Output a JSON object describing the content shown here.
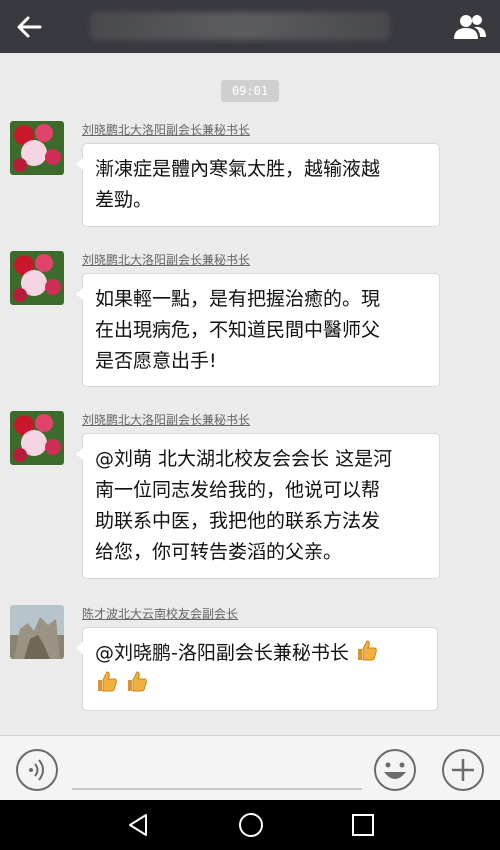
{
  "header": {
    "back_icon": "arrow-left-icon",
    "contacts_icon": "group-people-icon",
    "bg_color": "#393a3f"
  },
  "chat": {
    "timestamp": "09:01",
    "messages": [
      {
        "sender": "刘晓鹏北大洛阳副会长兼秘书长",
        "lines": [
          "漸凍症是體內寒氣太胜，越输液越",
          "差勁。"
        ]
      },
      {
        "sender": "刘晓鹏北大洛阳副会长兼秘书长",
        "lines": [
          "如果輕一點，是有把握治癒的。現",
          "在出現病危，不知道民間中醫师父",
          "是否愿意出手!"
        ]
      },
      {
        "sender": "刘晓鹏北大洛阳副会长兼秘书长",
        "lines": [
          "@刘萌 北大湖北校友会会长 这是河",
          "南一位同志发给我的，他说可以帮",
          "助联系中医，我把他的联系方法发",
          "给您，你可转告娄滔的父亲。"
        ]
      },
      {
        "sender": "陈才波北大云南校友会副会长",
        "lines": [
          "@刘晓鹏-洛阳副会长兼秘书长"
        ],
        "emoji": "thumbs-up-icon"
      }
    ]
  },
  "input_bar": {
    "voice_icon": "voice-icon",
    "emoji_icon": "smiley-icon",
    "more_icon": "plus-icon"
  },
  "system_nav": {
    "back_icon": "triangle-back-icon",
    "home_icon": "circle-home-icon",
    "recents_icon": "square-recents-icon"
  }
}
